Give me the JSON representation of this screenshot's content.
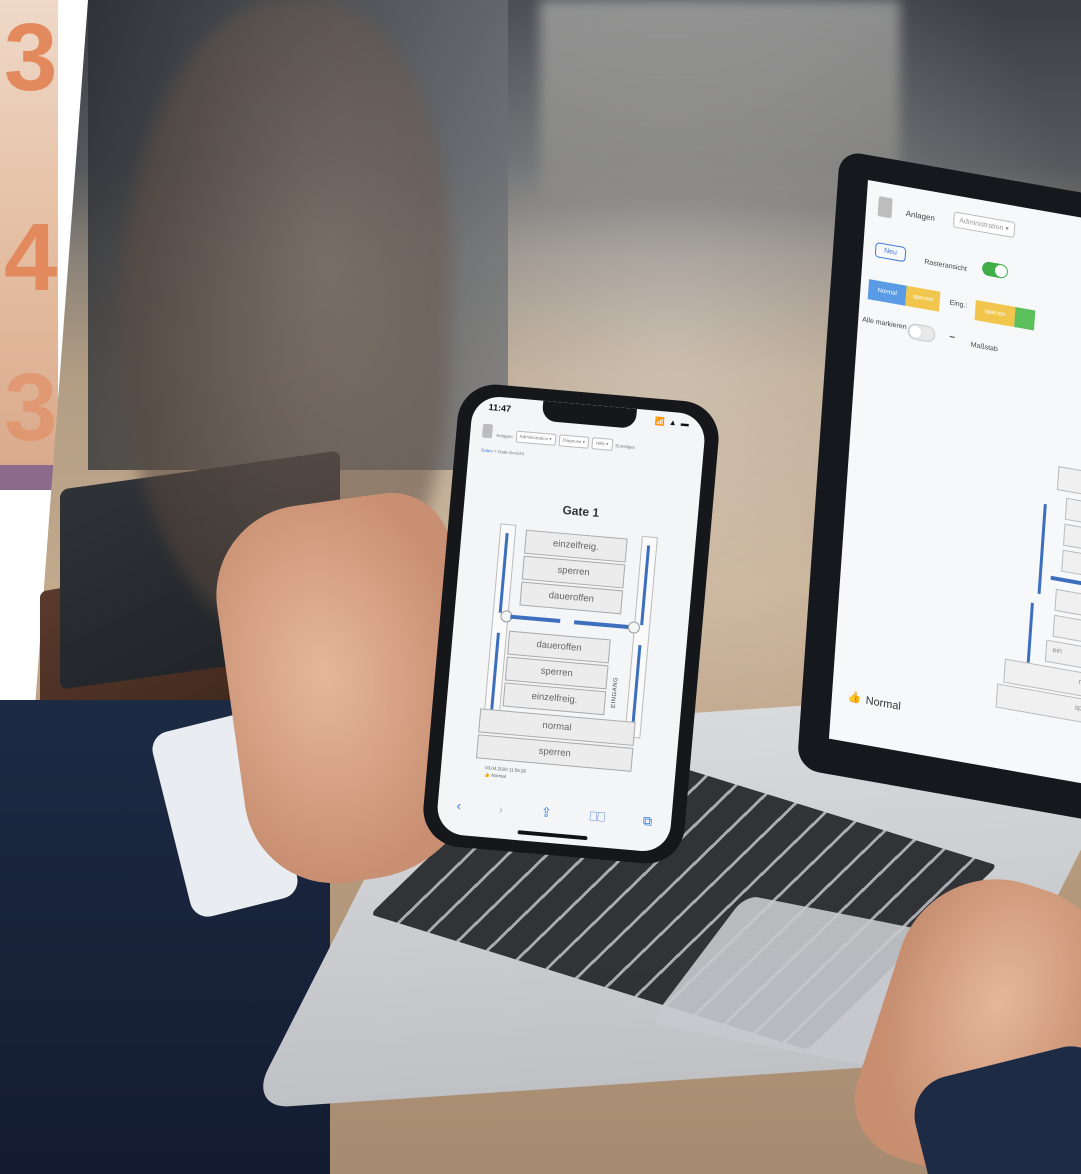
{
  "poster": {
    "numbers": [
      "3",
      "4",
      "3"
    ]
  },
  "phone": {
    "time": "11:47",
    "status_icons": "📶 ▲ ▬",
    "nav": {
      "anlagen": "Anlagen",
      "administration": "Administration ▾",
      "diagnose": "Diagnose ▾",
      "hilfe": "Hilfe ▾",
      "extra": "Sonstiges"
    },
    "breadcrumb": {
      "link": "Gates",
      "sep": " > ",
      "current": "Gate-Ansicht"
    },
    "gate_title": "Gate 1",
    "upper_buttons": [
      "einzelfreig.",
      "sperren",
      "daueroffen"
    ],
    "lower_buttons": [
      "daueroffen",
      "sperren",
      "einzelfreig."
    ],
    "eingang": "EINGANG",
    "wide_buttons": [
      "normal",
      "sperren"
    ],
    "timestamp": "03.04.2020 11:55:26",
    "status": "Normal",
    "toolbar": {
      "back": "‹",
      "forward": "›",
      "share": "⇪",
      "bookmarks": "⎕⎕",
      "tabs": "⧉"
    }
  },
  "laptop": {
    "anlagen": "Anlagen",
    "administration": "Administration ▾",
    "neu": "Neu",
    "rasteransicht": "Rasteransicht",
    "normal": "Normal",
    "sperren": "sperren",
    "eing": "Eing.:",
    "eing_sperren": "sperren",
    "alle_markieren": "Alle markieren",
    "minus": "−",
    "massstab": "Maßstab",
    "row_ein": "ein",
    "row_n": "n",
    "row_spe": "spe",
    "status_label": "Normal"
  }
}
